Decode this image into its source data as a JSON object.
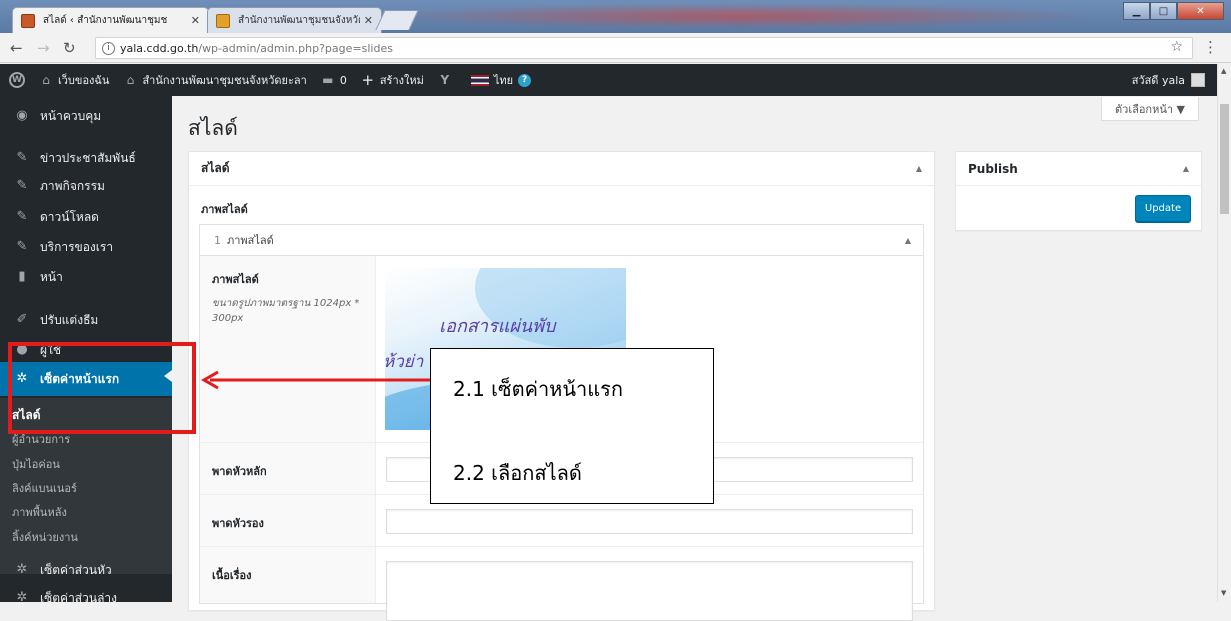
{
  "browser": {
    "tabs": [
      {
        "title": "สไลด์ ‹ สำนักงานพัฒนาชุมช",
        "active": true
      },
      {
        "title": "สำนักงานพัฒนาชุมชนจังหวัด",
        "active": false
      }
    ],
    "tab_close": "✕",
    "url_host": "yala.cdd.go.th",
    "url_path": "/wp-admin/admin.php?page=slides",
    "window_buttons": {
      "minimize": "▁",
      "maximize": "□",
      "close": "✕"
    }
  },
  "adminbar": {
    "items": [
      {
        "icon": "wordpress-icon",
        "label": ""
      },
      {
        "icon": "house-icon",
        "label": "เว็บของฉัน"
      },
      {
        "icon": "home-icon",
        "label": "สำนักงานพัฒนาชุมชนจังหวัดยะลา"
      },
      {
        "icon": "comment-icon",
        "label": "0"
      },
      {
        "icon": "plus-icon",
        "label": "สร้างใหม่"
      },
      {
        "icon": "yoast-icon",
        "label": ""
      },
      {
        "icon": "flag-icon",
        "label": "ไทย"
      }
    ],
    "greeting": "สวัสดี yala"
  },
  "sidebar": {
    "items": [
      {
        "icon": "dashboard-icon",
        "label": "หน้าควบคุม"
      },
      {
        "icon": "pin-icon",
        "label": "ข่าวประชาสัมพันธ์"
      },
      {
        "icon": "pin-icon",
        "label": "ภาพกิจกรรม"
      },
      {
        "icon": "pin-icon",
        "label": "ดาวน์โหลด"
      },
      {
        "icon": "pin-icon",
        "label": "บริการของเรา"
      },
      {
        "icon": "page-icon",
        "label": "หน้า"
      },
      {
        "icon": "brush-icon",
        "label": "ปรับแต่งธีม"
      },
      {
        "icon": "users-icon",
        "label": "ผู้ใช้"
      },
      {
        "icon": "gear-icon",
        "label": "เซ็ตค่าหน้าแรก"
      },
      {
        "icon": "gear-icon",
        "label": "เซ็ตค่าส่วนหัว"
      },
      {
        "icon": "gear-icon",
        "label": "เซ็ตค่าส่วนล่าง"
      }
    ],
    "submenu": [
      "สไลด์",
      "ผู้อำนวยการ",
      "ปุ่มไอค่อน",
      "ลิงค์แบนเนอร์",
      "ภาพพื้นหลัง",
      "ลิ้งค์หน่วยงาน"
    ]
  },
  "main": {
    "screen_options": "ตัวเลือกหน้า ▼",
    "page_title": "สไลด์",
    "box_title": "สไลด์",
    "group_label": "ภาพสไลด์",
    "row_number": "1",
    "row_title": "ภาพสไลด์",
    "fields": {
      "image_label": "ภาพสไลด์",
      "image_desc": "ขนาดรูปภาพมาตรฐาน 1024px * 300px",
      "headline_label": "พาดหัวหลัก",
      "subheadline_label": "พาดหัวรอง",
      "content_label": "เนื้อเรื่อง"
    },
    "slide_image_text": [
      "เอกสารแผ่นพับ",
      "ห้วย่า"
    ]
  },
  "publish": {
    "title": "Publish",
    "button": "Update"
  },
  "annotations": {
    "step1": "2.1 เซ็ตค่าหน้าแรก",
    "step2": "2.2 เลือกสไลด์"
  },
  "colors": {
    "adminbar_bg": "#23282d",
    "sidebar_current": "#0073aa",
    "update_button": "#0085ba",
    "annotation_red": "#e31b1b"
  }
}
